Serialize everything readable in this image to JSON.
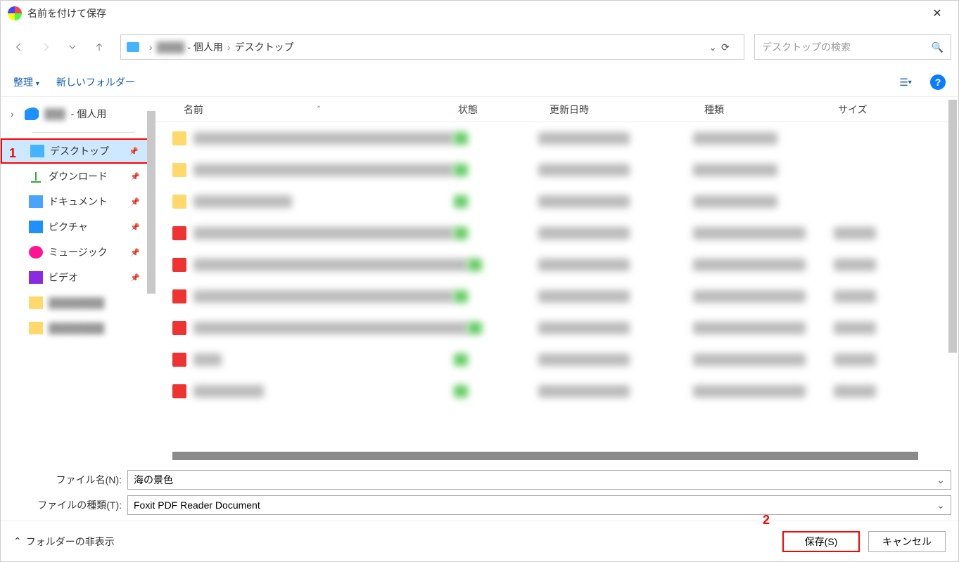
{
  "title": "名前を付けて保存",
  "breadcrumb": {
    "user_suffix": "- 個人用",
    "leaf": "デスクトップ"
  },
  "search": {
    "placeholder": "デスクトップの検索"
  },
  "toolbar": {
    "organize": "整理",
    "new_folder": "新しいフォルダー"
  },
  "sidebar": {
    "top_suffix": "- 個人用",
    "items": [
      {
        "label": "デスクトップ",
        "icon": "desktop",
        "selected": true
      },
      {
        "label": "ダウンロード",
        "icon": "download"
      },
      {
        "label": "ドキュメント",
        "icon": "document"
      },
      {
        "label": "ピクチャ",
        "icon": "picture"
      },
      {
        "label": "ミュージック",
        "icon": "music"
      },
      {
        "label": "ビデオ",
        "icon": "video"
      }
    ]
  },
  "columns": {
    "name": "名前",
    "state": "状態",
    "date": "更新日時",
    "type": "種類",
    "size": "サイズ"
  },
  "form": {
    "filename_label": "ファイル名(N):",
    "filename_value": "海の景色",
    "filetype_label": "ファイルの種類(T):",
    "filetype_value": "Foxit PDF Reader Document"
  },
  "footer": {
    "hide_folders": "フォルダーの非表示",
    "save": "保存(S)",
    "cancel": "キャンセル"
  },
  "annotations": {
    "one": "1",
    "two": "2"
  }
}
